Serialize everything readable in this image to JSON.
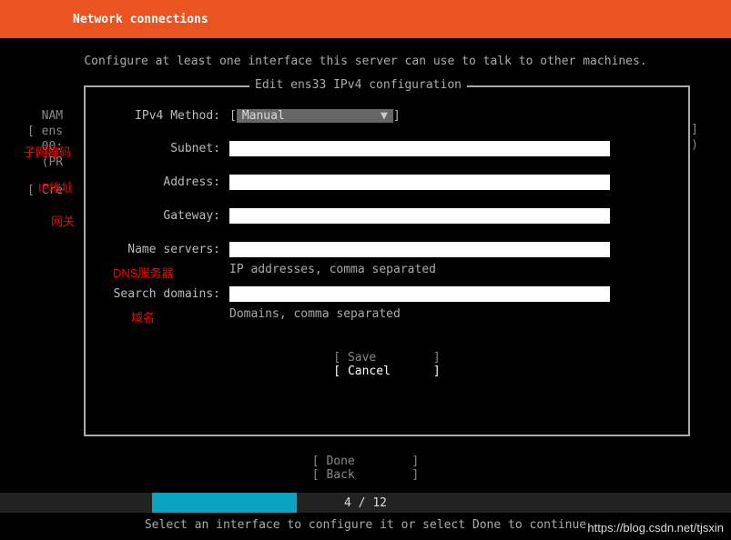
{
  "header": {
    "title": "Network connections"
  },
  "subtitle": "Configure at least one interface this server can use to talk to other machines.",
  "bg": {
    "line1": "  NAM",
    "line2": "[ ens",
    "line3": "  00:",
    "line4": "  (PR",
    "line5": "[ Cre",
    "rbr1": "]",
    "rbr2": ")"
  },
  "dialog": {
    "title": "Edit ens33 IPv4 configuration",
    "method_label": "IPv4 Method:",
    "method_value": "Manual",
    "fields": {
      "subnet": {
        "label": "Subnet:",
        "annot": "子网掩码"
      },
      "address": {
        "label": "Address:",
        "annot": "IP地址"
      },
      "gateway": {
        "label": "Gateway:",
        "annot": "网关"
      },
      "nameservers": {
        "label": "Name servers:",
        "hint": "IP addresses, comma separated",
        "annot": "DNS服务器"
      },
      "search": {
        "label": "Search domains:",
        "hint": "Domains, comma separated",
        "annot": "域名"
      }
    },
    "save": "Save",
    "cancel": "Cancel"
  },
  "footer": {
    "done": "Done",
    "back": "Back"
  },
  "progress": {
    "text": "4 / 12"
  },
  "bottom": "Select an interface to configure it or select Done to continue",
  "watermark": "https://blog.csdn.net/tjsxin"
}
